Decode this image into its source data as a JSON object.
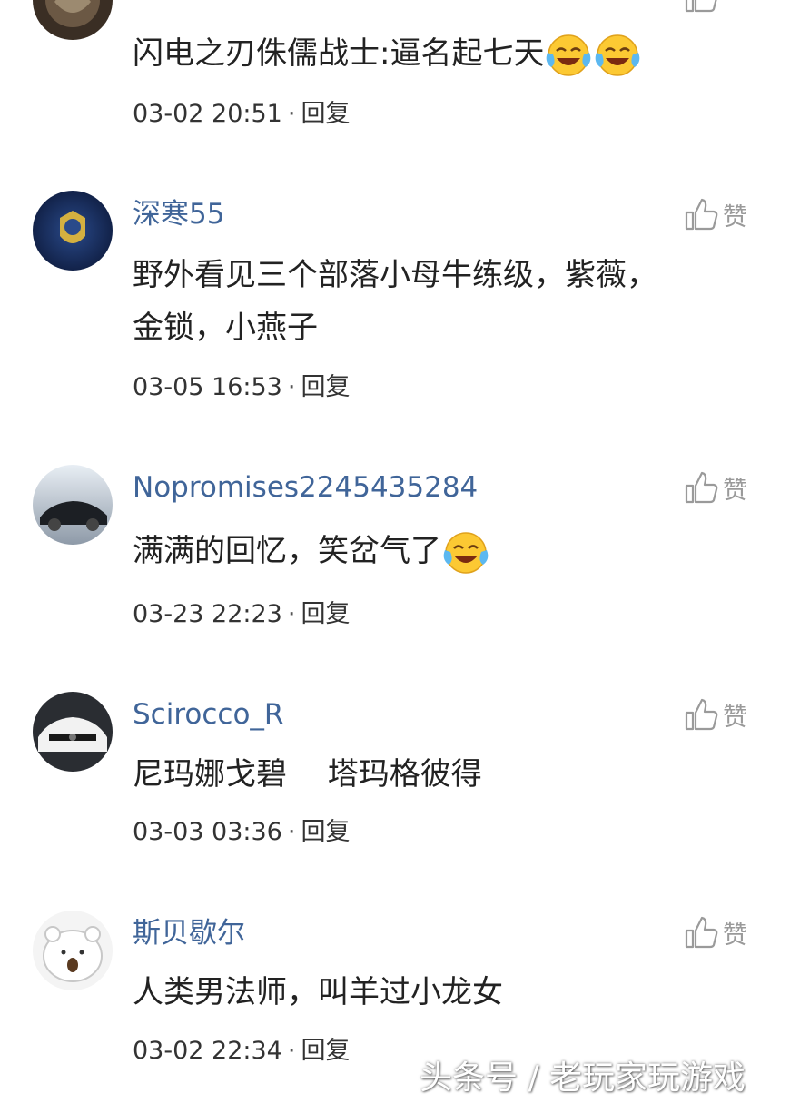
{
  "comments": [
    {
      "username": "",
      "content": "闪电之刃侏儒战士:逼名起七天",
      "date": "03-02 20:51",
      "reply_label": "回复",
      "like_label": "",
      "emoji_count": 2
    },
    {
      "username": "深寒55",
      "content_line1": "野外看见三个部落小母牛练级，紫薇，",
      "content_line2": "金锁，小燕子",
      "date": "03-05 16:53",
      "reply_label": "回复",
      "like_label": "赞"
    },
    {
      "username": "Nopromises2245435284",
      "content": "满满的回忆，笑岔气了",
      "date": "03-23 22:23",
      "reply_label": "回复",
      "like_label": "赞",
      "emoji_count": 1
    },
    {
      "username": "Scirocco_R",
      "content": "尼玛娜戈碧　 塔玛格彼得",
      "date": "03-03 03:36",
      "reply_label": "回复",
      "like_label": "赞"
    },
    {
      "username": "斯贝歇尔",
      "content": "人类男法师，叫羊过小龙女",
      "date": "03-02 22:34",
      "reply_label": "回复",
      "like_label": "赞"
    }
  ],
  "separator": "·",
  "watermark": "头条号 / 老玩家玩游戏",
  "icons": {
    "like": "thumbs-up-icon",
    "emoji": "laughing-crying-emoji"
  },
  "colors": {
    "username": "#406599",
    "text": "#222222",
    "meta": "#333333",
    "like": "#9a9a9a"
  }
}
